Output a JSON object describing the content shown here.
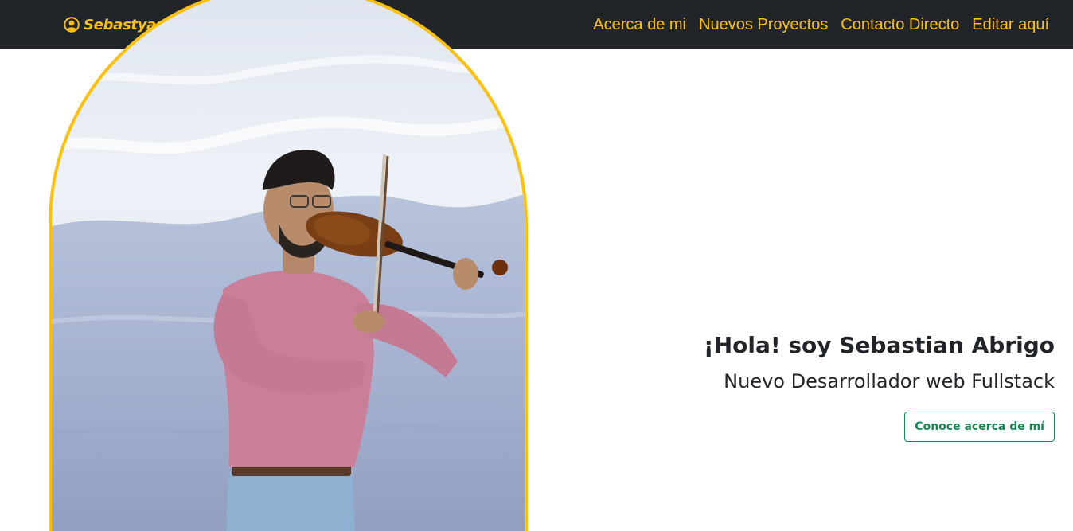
{
  "navbar": {
    "brand": {
      "icon": "person-circle-icon",
      "label": "Sebastyan C."
    },
    "links": [
      {
        "label": "Acerca de mi"
      },
      {
        "label": "Nuevos Proyectos"
      },
      {
        "label": "Contacto Directo"
      },
      {
        "label": "Editar aquí"
      }
    ]
  },
  "hero": {
    "title": "¡Hola! soy Sebastian Abrigo",
    "subtitle": "Nuevo Desarrollador web Fullstack",
    "button_label": "Conoce acerca de mí"
  },
  "colors": {
    "navbar_bg": "#212529",
    "accent": "#ffc107",
    "button": "#198754",
    "text": "#212529"
  }
}
